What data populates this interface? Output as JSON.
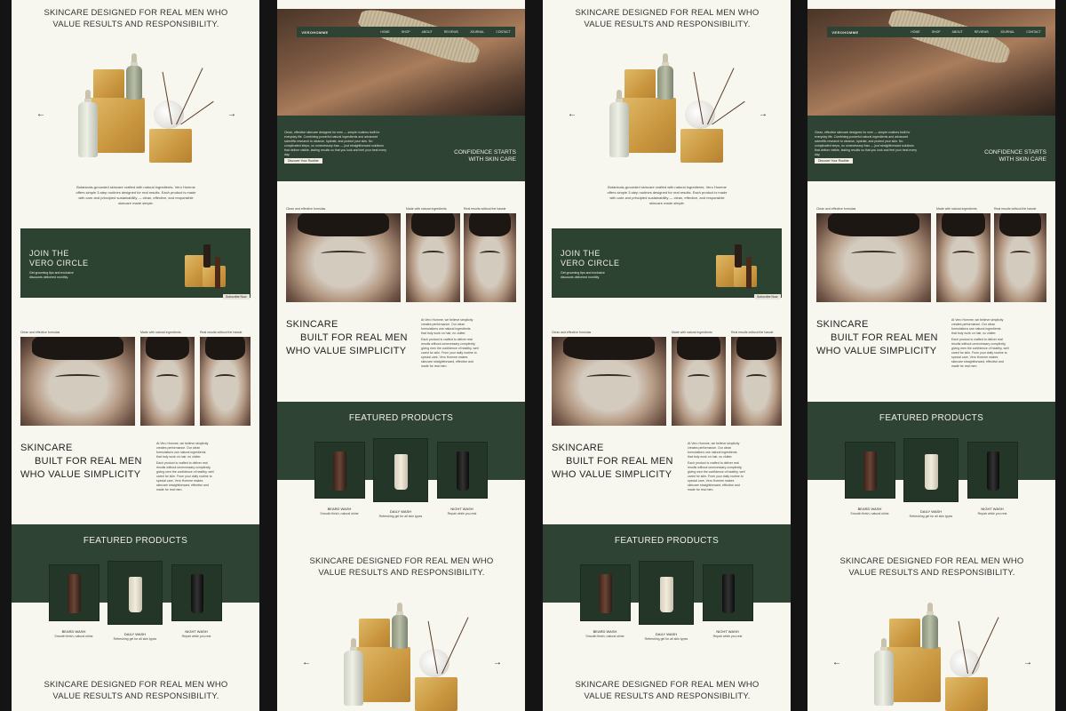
{
  "headline": "SKINCARE DESIGNED FOR REAL MEN WHO VALUE RESULTS AND RESPONSIBILITY.",
  "slider": {
    "prev_arrow": "←",
    "next_arrow": "→",
    "caption": "Botanicals-grounded skincare crafted with natural ingredients. Vero Homme offers simple 3-step routines designed for real results. Each product is made with care and principled sustainability — clean, effective, and responsible skincare made simple."
  },
  "banner": {
    "title_line1": "JOIN THE",
    "title_line2": "VERO CIRCLE",
    "text": "Get grooming tips and exclusive discounts delivered monthly.",
    "button": "Subscribe Now"
  },
  "photos": {
    "captions": [
      "Clean and effective formulas",
      "Made with natural ingredients",
      "Real results without the hassle"
    ]
  },
  "simplicity": {
    "line1": "SKINCARE",
    "line2": "BUILT FOR REAL MEN",
    "line3": "WHO VALUE SIMPLICITY",
    "para1": "At Vero Homme, we believe simplicity creates performance. Our clean formulations use natural ingredients that truly work on hair, no clutter.",
    "para2": "Each product is crafted to deliver real results without unnecessary complexity, giving men the confidence of healthy, well cared for skin. From your daily routine to special care, Vero Homme makes skincare straightforward, effective and made for real men."
  },
  "featured": {
    "title": "FEATURED PRODUCTS",
    "products": [
      {
        "name": "BEARD WASH",
        "desc": "Smooth finish, natural shine"
      },
      {
        "name": "DAILY WASH",
        "desc": "Refreshing gel for all skin types"
      },
      {
        "name": "NIGHT WASH",
        "desc": "Repair while you rest"
      }
    ]
  },
  "hero": {
    "logo": "VEROHOMME",
    "nav": [
      "HOME",
      "SHOP",
      "ABOUT",
      "REVIEWS",
      "JOURNAL",
      "CONTACT"
    ],
    "intro": "Clean, effective skincare designed for men — simple routines built for everyday life. Combining powerful natural ingredients and advanced scientific research to cleanse, hydrate, and protect your skin. No complicated steps, no unnecessary fuss — just straightforward solutions that deliver visible, lasting results so that you look and feel your best every day.",
    "cta": "Discover Your Routine",
    "tagline_line1": "CONFIDENCE STARTS",
    "tagline_line2": "WITH SKIN CARE"
  },
  "colors": {
    "green": "#2e4333",
    "cream": "#f8f7ef",
    "dark": "#141414"
  }
}
